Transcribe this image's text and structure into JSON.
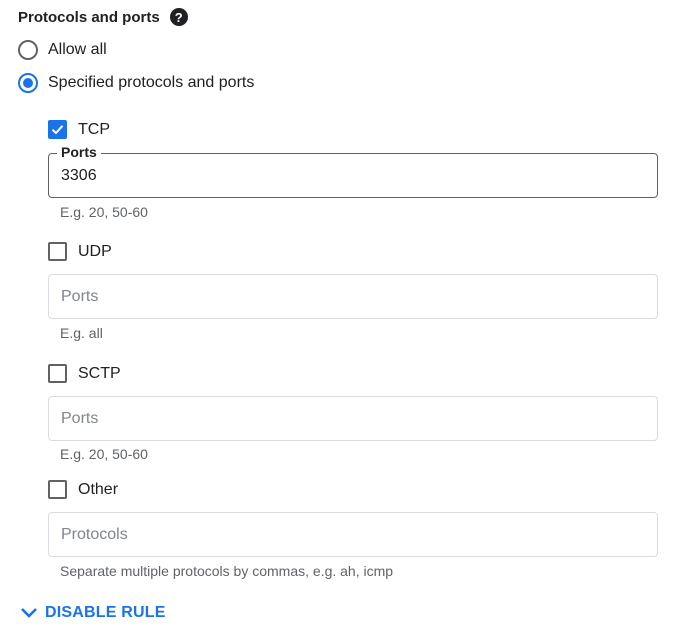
{
  "section": {
    "title": "Protocols and ports",
    "help_icon": "help-circle-icon"
  },
  "scope": {
    "options": [
      {
        "label": "Allow all",
        "checked": false
      },
      {
        "label": "Specified protocols and ports",
        "checked": true
      }
    ]
  },
  "protocols": {
    "tcp": {
      "label": "TCP",
      "checked": true,
      "field_label": "Ports",
      "value": "3306",
      "hint": "E.g. 20, 50-60"
    },
    "udp": {
      "label": "UDP",
      "checked": false,
      "placeholder": "Ports",
      "value": "",
      "hint": "E.g. all"
    },
    "sctp": {
      "label": "SCTP",
      "checked": false,
      "placeholder": "Ports",
      "value": "",
      "hint": "E.g. 20, 50-60"
    },
    "other": {
      "label": "Other",
      "checked": false,
      "placeholder": "Protocols",
      "value": "",
      "hint": "Separate multiple protocols by commas, e.g. ah, icmp"
    }
  },
  "footer": {
    "disable_rule_label": "DISABLE RULE",
    "disable_rule_icon": "chevron-down-icon"
  },
  "colors": {
    "accent": "#1a73e8",
    "text": "#202124",
    "hint": "#5f6368",
    "border": "#dadce0"
  }
}
